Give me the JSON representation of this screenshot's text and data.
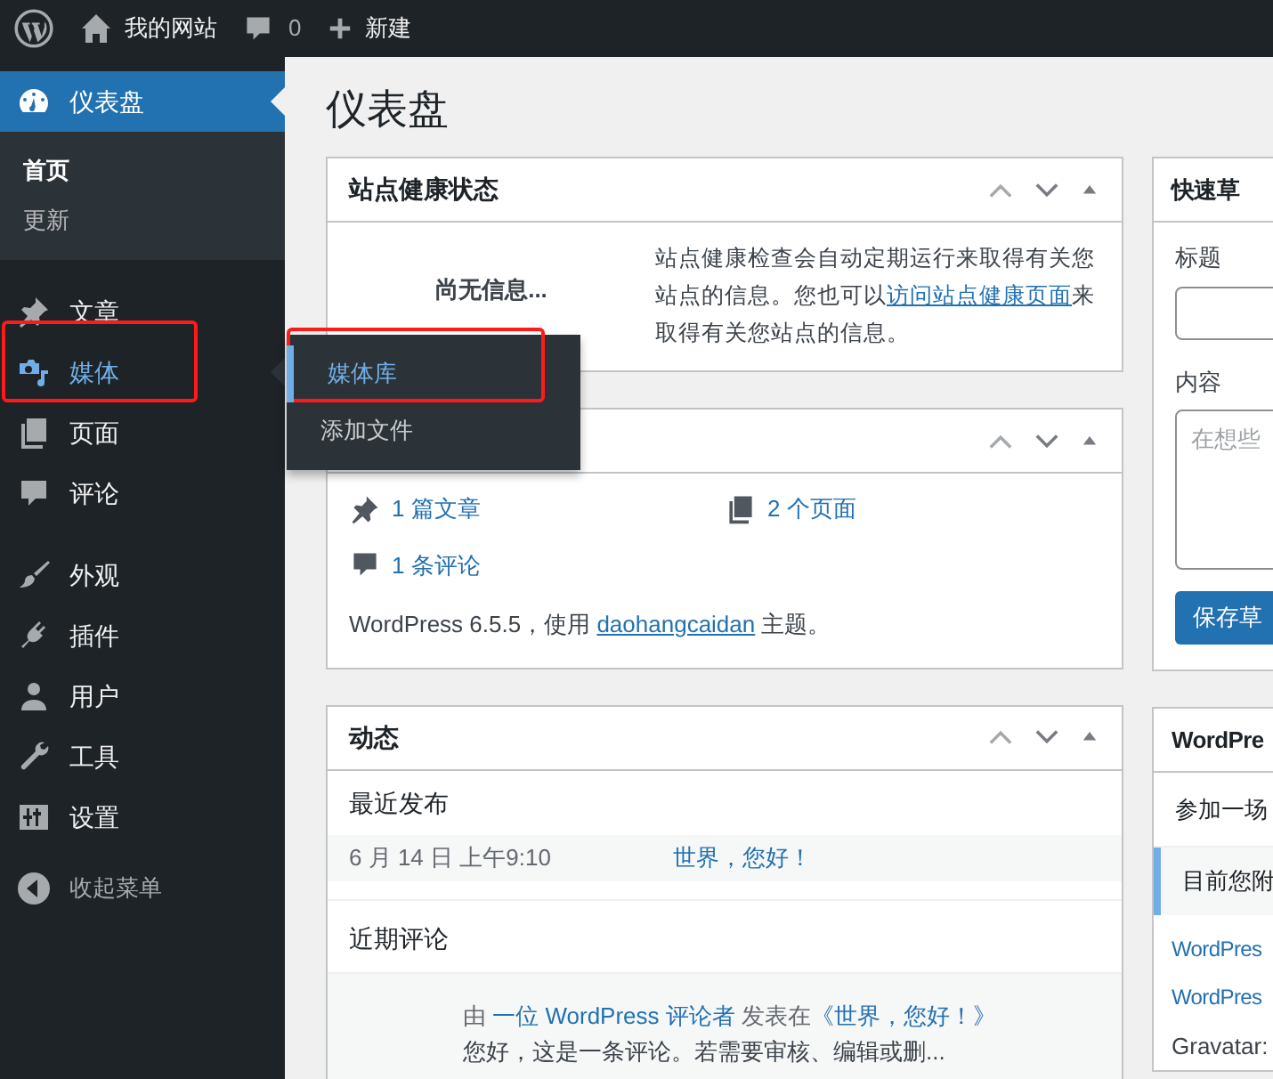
{
  "admin_bar": {
    "site_name": "我的网站",
    "comments_count": "0",
    "new_label": "新建"
  },
  "sidebar": {
    "groups": [
      {
        "items": [
          {
            "label": "仪表盘",
            "kind": "dashboard",
            "selected": true,
            "hovered": false,
            "highlighted": false,
            "submenu": [
              {
                "label": "首页",
                "selected": true
              },
              {
                "label": "更新",
                "selected": false
              }
            ]
          }
        ]
      },
      {
        "items": [
          {
            "label": "文章",
            "kind": "pin",
            "selected": false,
            "hovered": false,
            "highlighted": false
          },
          {
            "label": "媒体",
            "kind": "media",
            "selected": false,
            "hovered": true,
            "highlighted": true
          },
          {
            "label": "页面",
            "kind": "pages",
            "selected": false,
            "hovered": false,
            "highlighted": false
          },
          {
            "label": "评论",
            "kind": "comment",
            "selected": false,
            "hovered": false,
            "highlighted": false
          }
        ]
      },
      {
        "items": [
          {
            "label": "外观",
            "kind": "brush",
            "selected": false,
            "hovered": false,
            "highlighted": false
          },
          {
            "label": "插件",
            "kind": "plug",
            "selected": false,
            "hovered": false,
            "highlighted": false
          },
          {
            "label": "用户",
            "kind": "user",
            "selected": false,
            "hovered": false,
            "highlighted": false
          },
          {
            "label": "工具",
            "kind": "wrench",
            "selected": false,
            "hovered": false,
            "highlighted": false
          },
          {
            "label": "设置",
            "kind": "sliders",
            "selected": false,
            "hovered": false,
            "highlighted": false
          }
        ]
      }
    ],
    "collapse_label": "收起菜单"
  },
  "flyout": {
    "items": [
      {
        "label": "媒体库",
        "selected": true,
        "highlighted": true
      },
      {
        "label": "添加文件",
        "selected": false,
        "highlighted": false
      }
    ]
  },
  "page_title": "仪表盘",
  "site_health": {
    "title": "站点健康状态",
    "status": "尚无信息...",
    "description": "站点健康检查会自动定期运行来取得有关您站点的信息。您也可以",
    "link": "访问站点健康页面",
    "description_end": "来取得有关您站点的信息。"
  },
  "at_a_glance": {
    "items": [
      {
        "kind": "pin",
        "label": "1 篇文章"
      },
      {
        "kind": "pages",
        "label": "2 个页面"
      },
      {
        "kind": "comment",
        "label": "1 条评论"
      }
    ],
    "version_text": "WordPress 6.5.5，使用",
    "theme_link": "daohangcaidan",
    "version_end": "主题。"
  },
  "activity": {
    "title": "动态",
    "recent_heading": "最近发布",
    "posts": [
      {
        "date": "6 月 14 日 上午9:10",
        "title": "世界，您好！"
      }
    ],
    "comments_heading": "近期评论",
    "comments": [
      {
        "prefix": "由",
        "author": "一位 WordPress 评论者",
        "mid": "发表在",
        "post": "《世界，您好！》",
        "excerpt": "您好，这是一条评论。若需要审核、编辑或删..."
      }
    ]
  },
  "quick_draft": {
    "title": "快速草",
    "title_label": "标题",
    "content_label": "内容",
    "content_placeholder": "在想些",
    "save_button": "保存草"
  },
  "news": {
    "title": "WordPre",
    "intro": "参加一场",
    "notice": "目前您附",
    "links": [
      "WordPres",
      "WordPres"
    ],
    "footer": "Gravatar:"
  }
}
